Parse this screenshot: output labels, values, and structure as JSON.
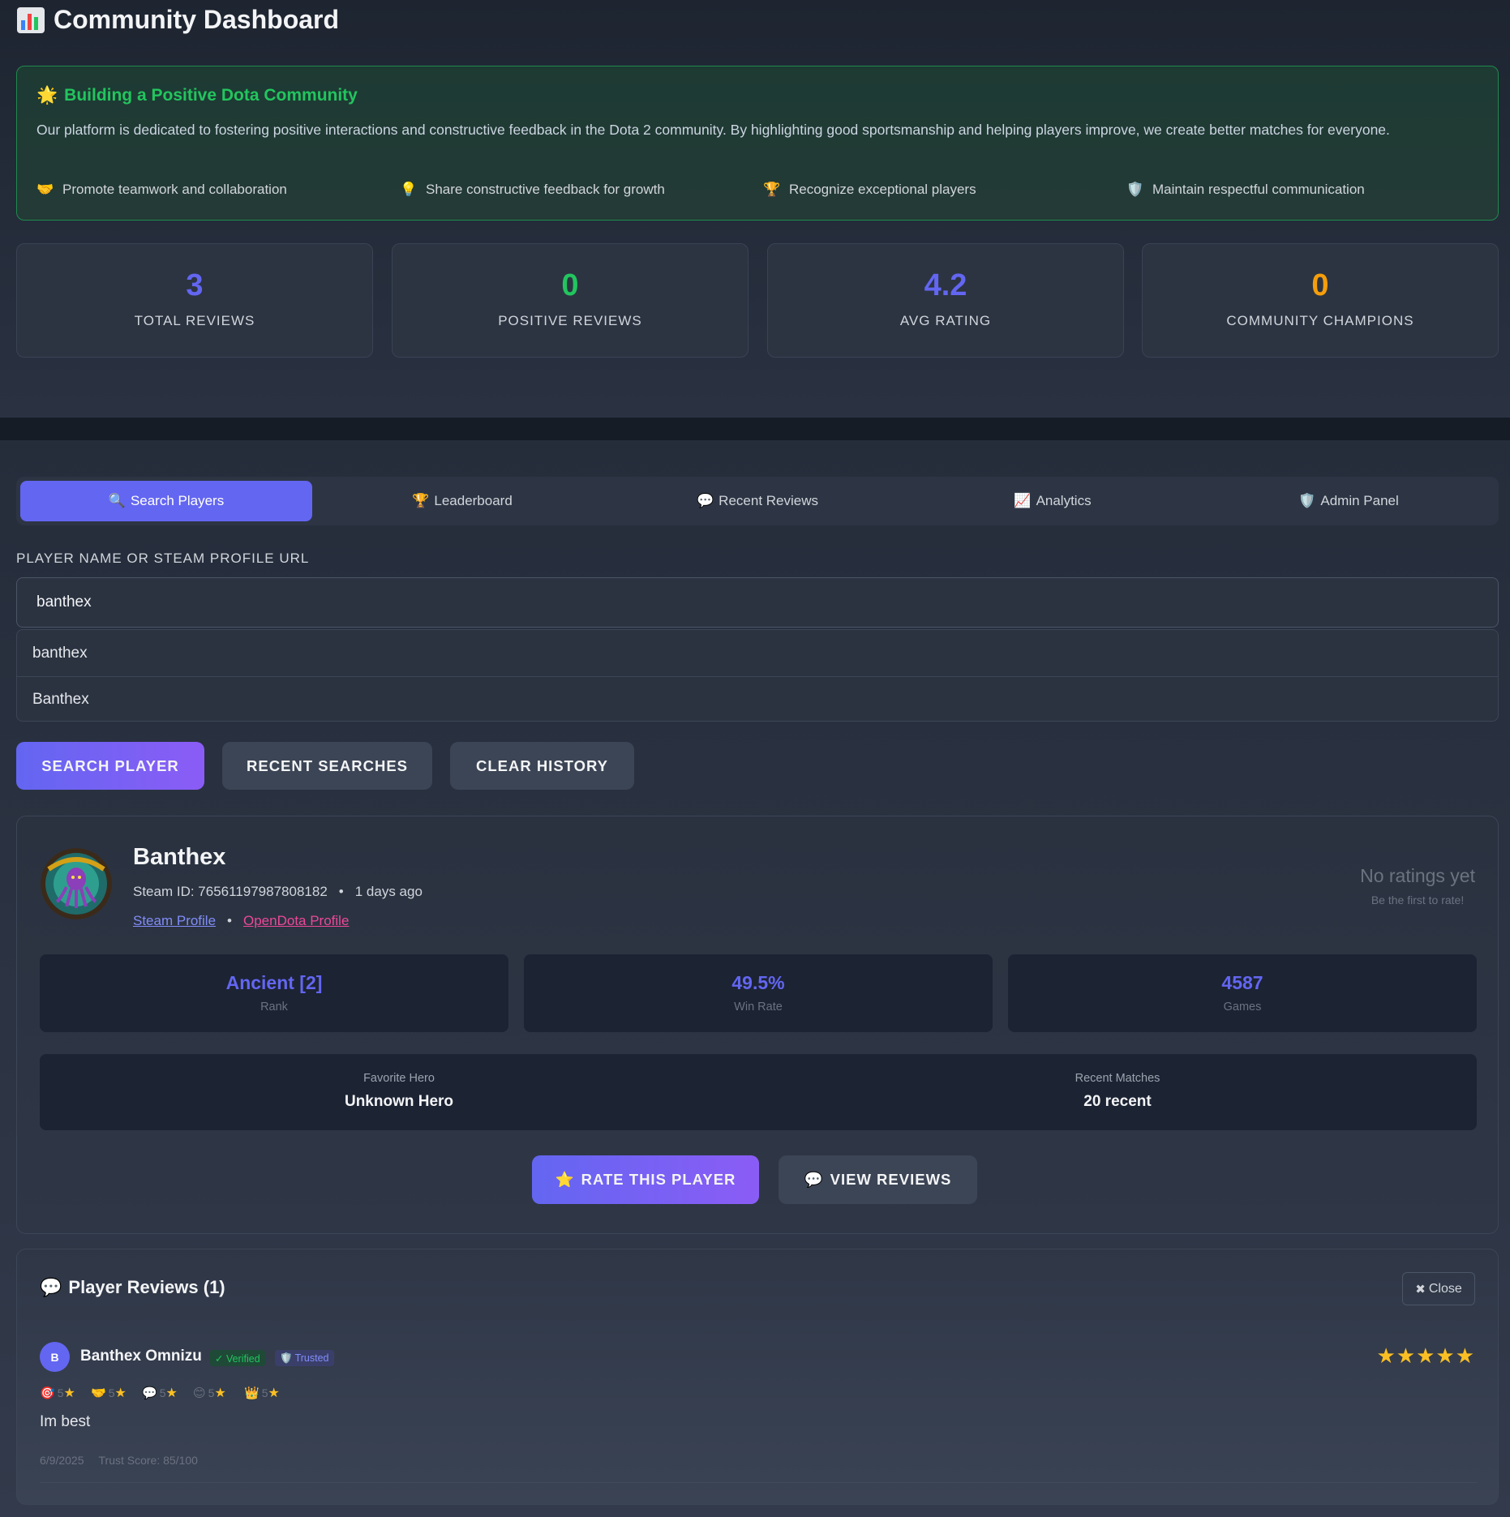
{
  "header": {
    "title": "Community Dashboard",
    "icon": "bar-chart-icon"
  },
  "mission": {
    "title": "Building a Positive Dota Community",
    "icon": "glowing-star-icon",
    "text": "Our platform is dedicated to fostering positive interactions and constructive feedback in the Dota 2 community. By highlighting good sportsmanship and helping players improve, we create better matches for everyone.",
    "points": [
      {
        "icon": "🤝",
        "label": "Promote teamwork and collaboration"
      },
      {
        "icon": "💡",
        "label": "Share constructive feedback for growth"
      },
      {
        "icon": "🏆",
        "label": "Recognize exceptional players"
      },
      {
        "icon": "🛡️",
        "label": "Maintain respectful communication"
      }
    ]
  },
  "stats": [
    {
      "value": "3",
      "label": "TOTAL REVIEWS",
      "color": "#6366f1"
    },
    {
      "value": "0",
      "label": "POSITIVE REVIEWS",
      "color": "#22c55e"
    },
    {
      "value": "4.2",
      "label": "AVG RATING",
      "color": "#6366f1"
    },
    {
      "value": "0",
      "label": "COMMUNITY CHAMPIONS",
      "color": "#f59e0b"
    }
  ],
  "tabs": [
    {
      "icon": "🔍",
      "label": "Search Players",
      "active": true
    },
    {
      "icon": "🏆",
      "label": "Leaderboard"
    },
    {
      "icon": "💬",
      "label": "Recent Reviews"
    },
    {
      "icon": "📈",
      "label": "Analytics"
    },
    {
      "icon": "🛡️",
      "label": "Admin Panel"
    }
  ],
  "search": {
    "label": "PLAYER NAME OR STEAM PROFILE URL",
    "value": "banthex",
    "suggestions": [
      "banthex",
      "Banthex"
    ],
    "buttons": {
      "search": "SEARCH PLAYER",
      "recent": "RECENT SEARCHES",
      "clear": "CLEAR HISTORY"
    }
  },
  "player": {
    "name": "Banthex",
    "steam_id": "Steam ID: 76561197987808182",
    "last_seen": "1 days ago",
    "steam_link": "Steam Profile",
    "opendota_link": "OpenDota Profile",
    "no_ratings": "No ratings yet",
    "no_ratings_sub": "Be the first to rate!",
    "rank": "Ancient [2]",
    "rank_label": "Rank",
    "win_rate": "49.5%",
    "win_rate_label": "Win Rate",
    "games": "4587",
    "games_label": "Games",
    "fav_hero_label": "Favorite Hero",
    "fav_hero": "Unknown Hero",
    "recent_label": "Recent Matches",
    "recent": "20 recent",
    "rate_button": "RATE THIS PLAYER",
    "reviews_button": "VIEW REVIEWS"
  },
  "reviews": {
    "title": "Player Reviews (1)",
    "close": "Close",
    "items": [
      {
        "initial": "B",
        "author": "Banthex Omnizu",
        "verified": "✓ Verified",
        "trusted": "Trusted",
        "stars": "★★★★★",
        "categories": [
          {
            "icon": "🎯",
            "score": "5"
          },
          {
            "icon": "🤝",
            "score": "5"
          },
          {
            "icon": "💬",
            "score": "5"
          },
          {
            "icon": "😊",
            "score": "5"
          },
          {
            "icon": "👑",
            "score": "5"
          }
        ],
        "text": "Im best",
        "date": "6/9/2025",
        "trust": "Trust Score: 85/100"
      }
    ]
  }
}
